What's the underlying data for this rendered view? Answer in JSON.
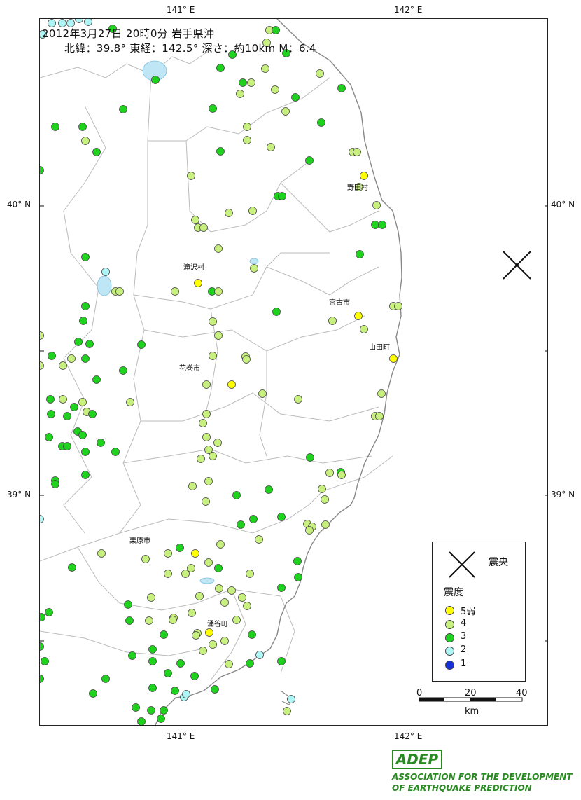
{
  "header": {
    "line1": "2012年3月27日 20時0分 岩手県沖",
    "line2": "北緯：39.8° 東経：142.5° 深さ：約10km M：6.4"
  },
  "axes": {
    "lon_labels": [
      "141° E",
      "142° E"
    ],
    "lat_labels": [
      "40° N",
      "39° N"
    ]
  },
  "places": [
    "野田村",
    "滝沢村",
    "宮古市",
    "山田町",
    "花巻市",
    "栗原市",
    "涌谷町"
  ],
  "legend": {
    "epicenter_label": "震央",
    "title": "震度",
    "items": [
      {
        "label": "5弱",
        "color": "#ffff00"
      },
      {
        "label": "4",
        "color": "#c8f07e"
      },
      {
        "label": "3",
        "color": "#1ed21e"
      },
      {
        "label": "2",
        "color": "#aef5f5"
      },
      {
        "label": "1",
        "color": "#1530d8"
      }
    ]
  },
  "scale": {
    "ticks": [
      "0",
      "20",
      "40"
    ],
    "unit": "km"
  },
  "logo": {
    "mark": "ADEP",
    "line1": "ASSOCIATION FOR THE DEVELOPMENT",
    "line2": "OF EARTHQUAKE PREDICTION"
  },
  "colors": {
    "coast": "#888888",
    "boundary": "#bbbbbb",
    "water": "#bfe6f5"
  }
}
